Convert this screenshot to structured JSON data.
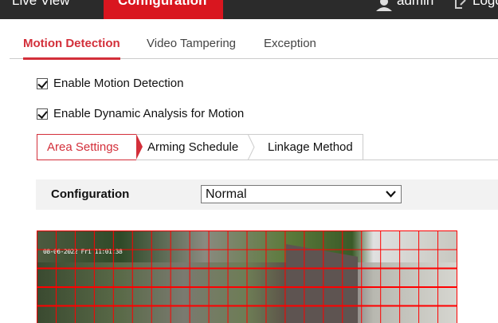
{
  "topbar": {
    "live_view": "Live View",
    "configuration": "Configuration",
    "user": "admin",
    "logout": "Logout"
  },
  "tabs": [
    {
      "label": "Motion Detection",
      "active": true
    },
    {
      "label": "Video Tampering"
    },
    {
      "label": "Exception"
    }
  ],
  "checkboxes": [
    {
      "label": "Enable Motion Detection",
      "checked": true
    },
    {
      "label": "Enable Dynamic Analysis for Motion",
      "checked": true
    }
  ],
  "steps": [
    {
      "label": "Area Settings",
      "active": true
    },
    {
      "label": "Arming Schedule"
    },
    {
      "label": "Linkage Method"
    }
  ],
  "config": {
    "label": "Configuration",
    "value": "Normal"
  },
  "video": {
    "timestamp": "08-06-2022 Fri 11:01:38",
    "grid_color": "#ff0000",
    "grid_columns": 22,
    "grid_rows": 18
  },
  "colors": {
    "accent": "#d9161f",
    "topbar": "#2b2b2b"
  }
}
